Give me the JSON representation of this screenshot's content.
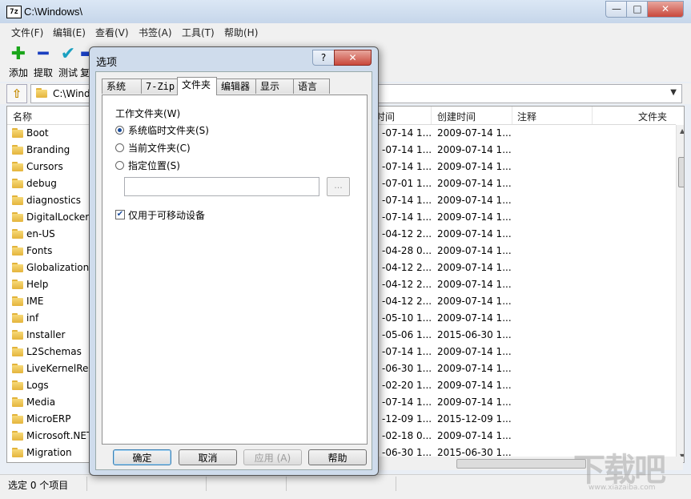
{
  "window": {
    "title": "C:\\Windows\\",
    "icon_text": "7z",
    "controls": {
      "minimize": "—",
      "maximize": "□",
      "close": "✕"
    }
  },
  "menu": [
    "文件(F)",
    "编辑(E)",
    "查看(V)",
    "书签(A)",
    "工具(T)",
    "帮助(H)"
  ],
  "toolbar": [
    {
      "label": "添加",
      "icon": "plus-icon",
      "color": "#1aa51a"
    },
    {
      "label": "提取",
      "icon": "minus-icon",
      "color": "#1a3fc0"
    },
    {
      "label": "测试",
      "icon": "check-icon",
      "color": "#1aa0c0"
    },
    {
      "label": "复",
      "icon": "arrow-icon",
      "color": "#1a3fc0"
    }
  ],
  "address": {
    "path": "C:\\Windows\\"
  },
  "columns": [
    "名称",
    "时间",
    "创建时间",
    "注释",
    "文件夹"
  ],
  "files": [
    {
      "name": "Boot",
      "modified": "-07-14 1...",
      "created": "2009-07-14 1..."
    },
    {
      "name": "Branding",
      "modified": "-07-14 1...",
      "created": "2009-07-14 1..."
    },
    {
      "name": "Cursors",
      "modified": "-07-14 1...",
      "created": "2009-07-14 1..."
    },
    {
      "name": "debug",
      "modified": "-07-01 1...",
      "created": "2009-07-14 1..."
    },
    {
      "name": "diagnostics",
      "modified": "-07-14 1...",
      "created": "2009-07-14 1..."
    },
    {
      "name": "DigitalLocker",
      "modified": "-07-14 1...",
      "created": "2009-07-14 1..."
    },
    {
      "name": "en-US",
      "modified": "-04-12 2...",
      "created": "2009-07-14 1..."
    },
    {
      "name": "Fonts",
      "modified": "-04-28 0...",
      "created": "2009-07-14 1..."
    },
    {
      "name": "Globalization",
      "modified": "-04-12 2...",
      "created": "2009-07-14 1..."
    },
    {
      "name": "Help",
      "modified": "-04-12 2...",
      "created": "2009-07-14 1..."
    },
    {
      "name": "IME",
      "modified": "-04-12 2...",
      "created": "2009-07-14 1..."
    },
    {
      "name": "inf",
      "modified": "-05-10 1...",
      "created": "2009-07-14 1..."
    },
    {
      "name": "Installer",
      "modified": "-05-06 1...",
      "created": "2015-06-30 1..."
    },
    {
      "name": "L2Schemas",
      "modified": "-07-14 1...",
      "created": "2009-07-14 1..."
    },
    {
      "name": "LiveKernelReports",
      "modified": "-06-30 1...",
      "created": "2009-07-14 1..."
    },
    {
      "name": "Logs",
      "modified": "-02-20 1...",
      "created": "2009-07-14 1..."
    },
    {
      "name": "Media",
      "modified": "-07-14 1...",
      "created": "2009-07-14 1..."
    },
    {
      "name": "MicroERP",
      "modified": "-12-09 1...",
      "created": "2015-12-09 1..."
    },
    {
      "name": "Microsoft.NET",
      "modified": "-02-18 0...",
      "created": "2009-07-14 1..."
    },
    {
      "name": "Migration",
      "modified": "-06-30 1...",
      "created": "2015-06-30 1..."
    }
  ],
  "status": {
    "text": "选定 0 个项目"
  },
  "watermark": {
    "text": "下载吧",
    "sub": "www.xiazaiba.com"
  },
  "dialog": {
    "title": "选项",
    "help": "?",
    "close": "✕",
    "tabs": [
      "系统",
      "7-Zip",
      "文件夹",
      "编辑器",
      "显示",
      "语言"
    ],
    "active_tab": "文件夹",
    "group_label": "工作文件夹(W)",
    "radios": [
      {
        "label": "系统临时文件夹(S)",
        "checked": true
      },
      {
        "label": "当前文件夹(C)",
        "checked": false
      },
      {
        "label": "指定位置(S)",
        "checked": false
      }
    ],
    "path_value": "",
    "browse_label": "...",
    "checkbox": {
      "label": "仅用于可移动设备",
      "checked": true
    },
    "buttons": {
      "ok": "确定",
      "cancel": "取消",
      "apply": "应用 (A)",
      "help": "帮助"
    }
  }
}
